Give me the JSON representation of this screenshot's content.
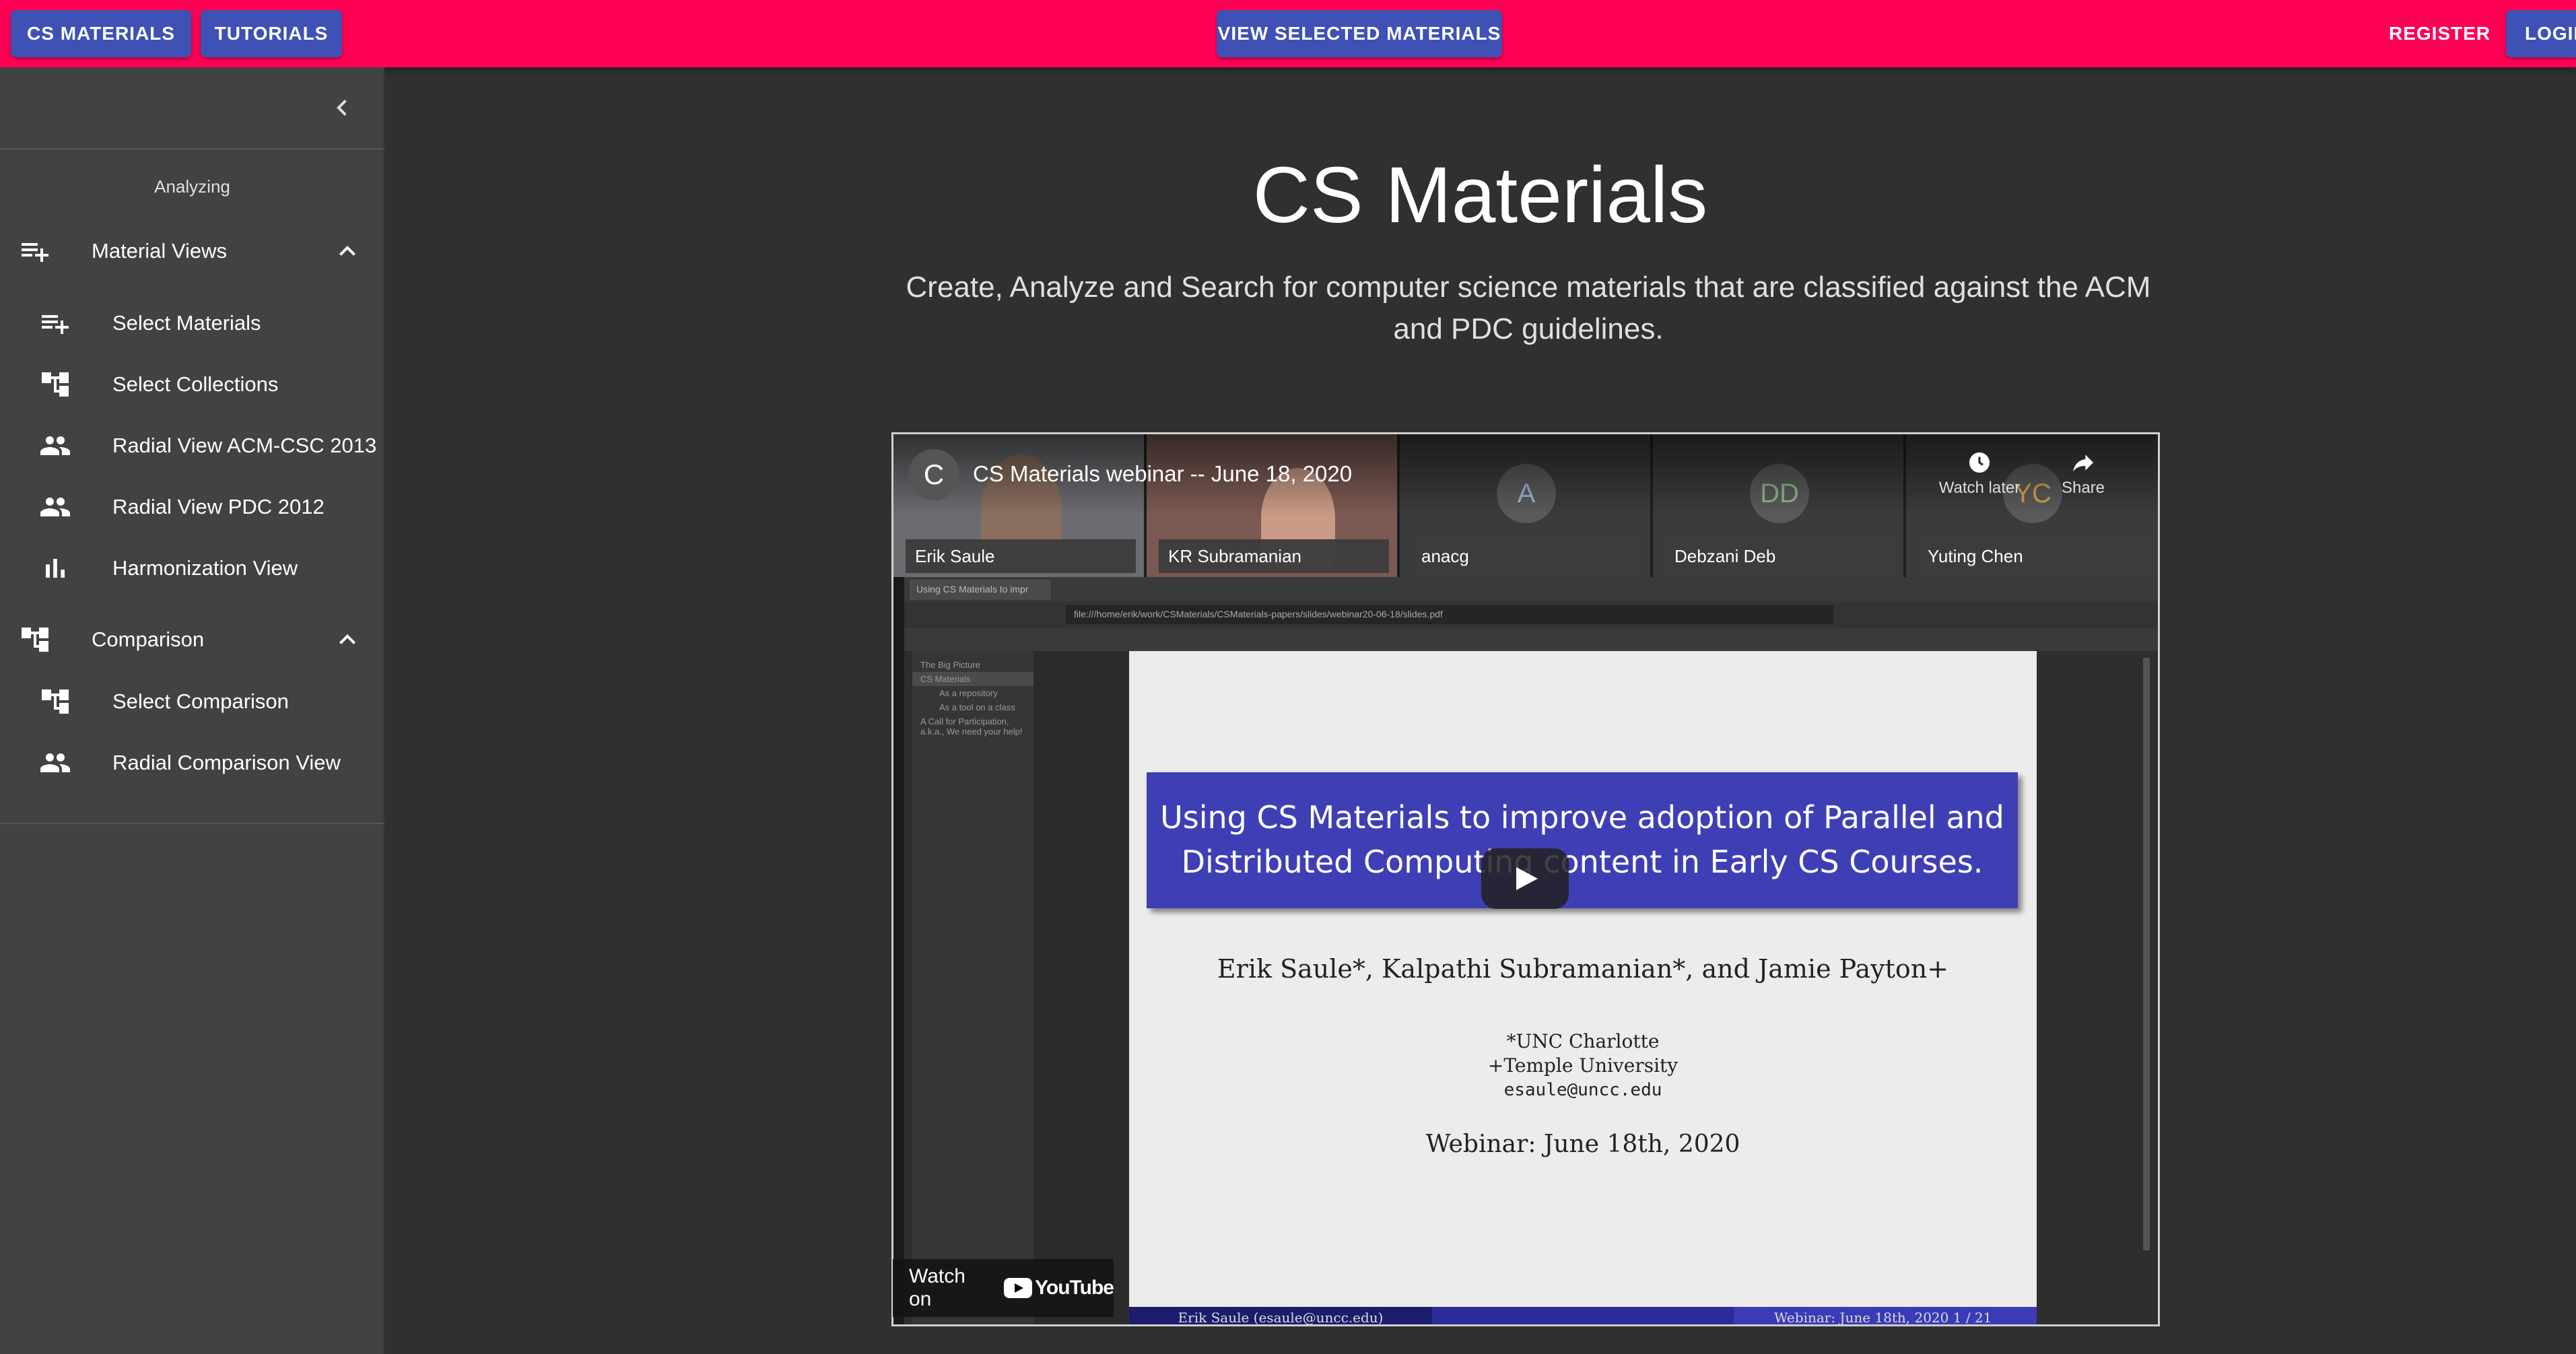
{
  "appbar": {
    "cs_materials": "CS MATERIALS",
    "tutorials": "TUTORIALS",
    "view_selected": "VIEW SELECTED MATERIALS",
    "register": "REGISTER",
    "login": "LOGIN",
    "color": "#ff0055",
    "button_color": "#3f51b5"
  },
  "sidebar": {
    "section_title": "Analyzing",
    "groups": [
      {
        "label": "Material Views",
        "icon": "playlist-add-icon",
        "expanded": true,
        "items": [
          {
            "label": "Select Materials",
            "icon": "playlist-add-icon"
          },
          {
            "label": "Select Collections",
            "icon": "account-tree-icon"
          },
          {
            "label": "Radial View ACM-CSC 2013",
            "icon": "people-icon"
          },
          {
            "label": "Radial View PDC 2012",
            "icon": "people-icon"
          },
          {
            "label": "Harmonization View",
            "icon": "bar-chart-icon"
          }
        ]
      },
      {
        "label": "Comparison",
        "icon": "account-tree-icon",
        "expanded": true,
        "items": [
          {
            "label": "Select Comparison",
            "icon": "account-tree-icon"
          },
          {
            "label": "Radial Comparison View",
            "icon": "people-icon"
          }
        ]
      }
    ]
  },
  "main": {
    "title": "CS Materials",
    "subtitle": "Create, Analyze and Search for computer science materials that are classified against the ACM and PDC guidelines."
  },
  "video": {
    "channel_initial": "C",
    "title": "CS Materials webinar -- June 18, 2020",
    "watch_later": "Watch later",
    "share": "Share",
    "participants": [
      {
        "name": "Erik Saule"
      },
      {
        "name": "KR Subramanian"
      },
      {
        "name": "anacg",
        "initials": "A"
      },
      {
        "name": "Debzani Deb",
        "initials": "DD"
      },
      {
        "name": "Yuting Chen",
        "initials": "YC"
      }
    ],
    "browser_tab": "Using CS Materials to impr",
    "browser_url": "file:///home/erik/work/CSMaterials/CSMaterials-papers/slides/webinar20-06-18/slides.pdf",
    "outline": [
      "The Big Picture",
      "CS Materials",
      "As a repository",
      "As a tool on a class",
      "A Call for Participation, a.k.a., We need your help!"
    ],
    "slide": {
      "heading_line1": "Using CS Materials to improve adoption of Parallel and",
      "heading_line2": "Distributed Computing content in Early CS Courses.",
      "authors": "Erik Saule*, Kalpathi Subramanian*, and Jamie Payton+",
      "affiliation1": "*UNC Charlotte",
      "affiliation2": "+Temple University",
      "email": "esaule@uncc.edu",
      "date": "Webinar:  June 18th, 2020",
      "footer_left": "Erik Saule  (esaule@uncc.edu)",
      "footer_right": "Webinar:  June 18th, 2020      1 / 21"
    },
    "watch_on": "Watch on",
    "youtube": "YouTube"
  }
}
